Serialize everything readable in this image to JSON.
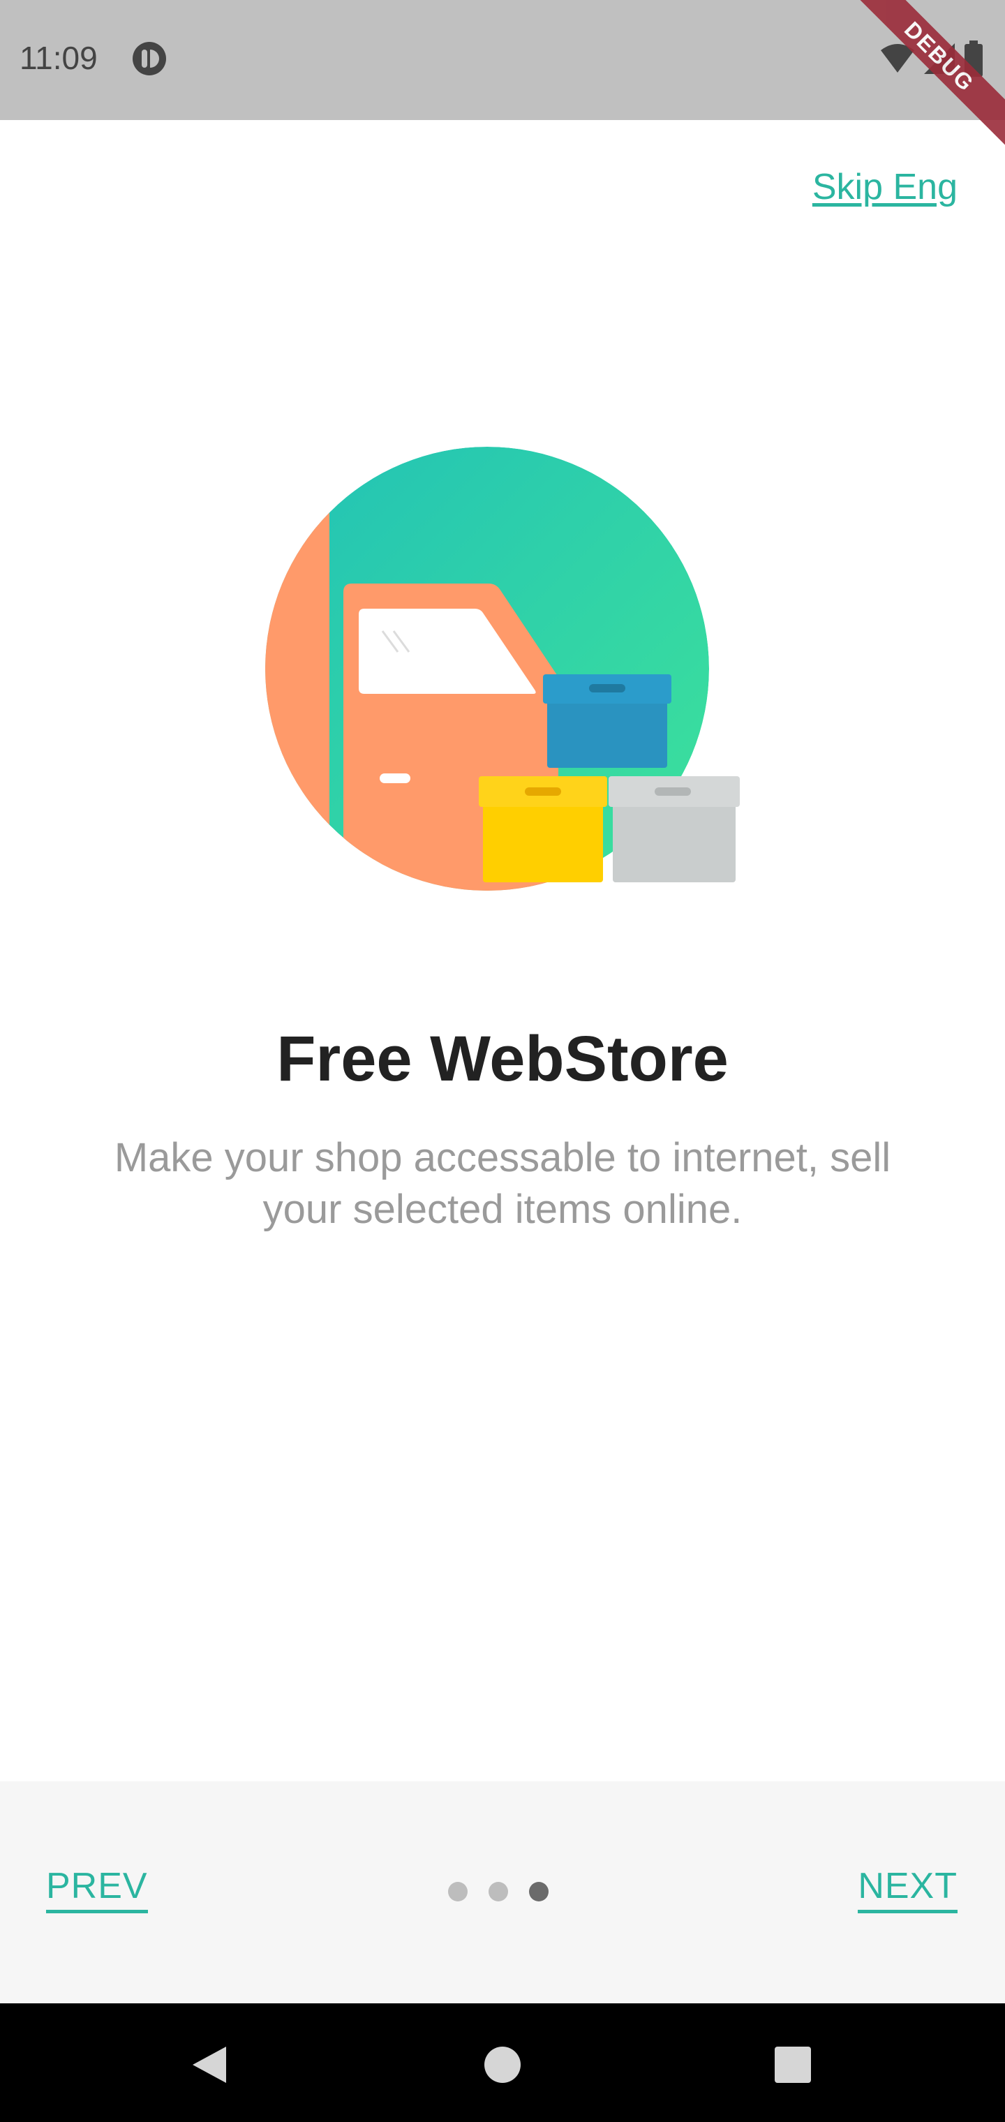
{
  "status_bar": {
    "time": "11:09",
    "debug_label": "DEBUG"
  },
  "header": {
    "skip_label": "Skip Eng"
  },
  "slide": {
    "title": "Free WebStore",
    "description": "Make your shop accessable to internet, sell your selected items online."
  },
  "pagination": {
    "total": 3,
    "active_index": 2
  },
  "footer": {
    "prev_label": "PREV",
    "next_label": "NEXT"
  },
  "colors": {
    "accent": "#2bb5a0",
    "teal_circle": "#2ec9b3",
    "orange": "#ff9a6a",
    "box_blue": "#2a93c0",
    "box_yellow": "#ffcf00",
    "box_gray": "#c9cdcd"
  },
  "icons": {
    "status_app": "app-status-icon",
    "wifi": "wifi-icon",
    "signal": "signal-icon",
    "battery": "battery-icon",
    "back": "back-triangle-icon",
    "home": "home-circle-icon",
    "recents": "recents-square-icon"
  }
}
